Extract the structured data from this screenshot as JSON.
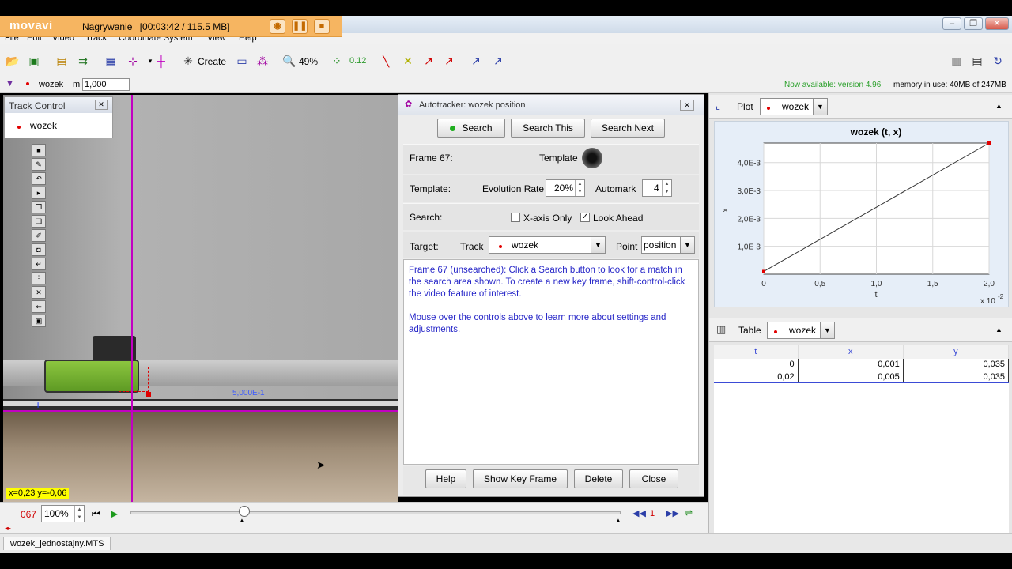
{
  "recorder": {
    "logo": "movavi",
    "status": "Nagrywanie",
    "timer": "[00:03:42 / 115.5 MB]"
  },
  "menu": [
    "File",
    "Edit",
    "Video",
    "Track",
    "Coordinate System",
    "View",
    "Help"
  ],
  "toolbar": {
    "create_label": "Create",
    "zoom_label": "49%",
    "decimal_label": "0.12"
  },
  "trackbar": {
    "track_name": "wozek",
    "mass_label": "m",
    "mass_value": "1,000",
    "update_notice": "Now available: version 4.96",
    "memory": "memory in use: 40MB of 247MB"
  },
  "video": {
    "coordinate_readout": "x=0,23  y=-0,06",
    "scale_label": "5,000E-1"
  },
  "track_control": {
    "title": "Track Control",
    "item": "wozek"
  },
  "player": {
    "frame": "067",
    "zoom": "100%",
    "step": "1"
  },
  "file_tab": "wozek_jednostajny.MTS",
  "autotracker": {
    "title": "Autotracker: wozek position",
    "search_button": "Search",
    "search_this_button": "Search This",
    "search_next_button": "Search Next",
    "frame_label": "Frame 67:",
    "template_label": "Template",
    "template_row_label": "Template:",
    "evolution_rate_label": "Evolution Rate",
    "evolution_rate_value": "20%",
    "automark_label": "Automark",
    "automark_value": "4",
    "search_row_label": "Search:",
    "x_axis_only_label": "X-axis Only",
    "x_axis_only_checked": false,
    "look_ahead_label": "Look Ahead",
    "look_ahead_checked": true,
    "target_label": "Target:",
    "track_label": "Track",
    "track_value": "wozek",
    "point_label": "Point",
    "point_value": "position",
    "message_1": "Frame 67 (unsearched): Click a Search button to look for a match in the search area shown. To create a new key frame, shift-control-click the video feature of interest.",
    "message_2": "Mouse over the controls above to learn more about settings and adjustments.",
    "help_button": "Help",
    "show_key_frame_button": "Show Key Frame",
    "delete_button": "Delete",
    "close_button": "Close"
  },
  "plot_panel": {
    "tab_label": "Plot",
    "track": "wozek"
  },
  "table_panel": {
    "tab_label": "Table",
    "track": "wozek",
    "columns": [
      "t",
      "x",
      "y"
    ],
    "rows": [
      [
        "0",
        "0,001",
        "0,035"
      ],
      [
        "0,02",
        "0,005",
        "0,035"
      ]
    ]
  },
  "chart_data": {
    "type": "line",
    "title": "wozek (t, x)",
    "xlabel": "t",
    "ylabel": "x",
    "x_exponent_label": "x 10",
    "x_exponent_power": "-2",
    "x_ticks": [
      "0",
      "0,5",
      "1,0",
      "1,5",
      "2,0"
    ],
    "y_ticks": [
      "1,0E-3",
      "2,0E-3",
      "3,0E-3",
      "4,0E-3"
    ],
    "xlim": [
      0,
      2.0
    ],
    "ylim": [
      0,
      0.0047
    ],
    "series": [
      {
        "x": [
          0,
          2.0
        ],
        "y": [
          0.0001,
          0.0047
        ],
        "color": "#333333",
        "marker_color": "#e20000"
      }
    ],
    "grid": true
  }
}
